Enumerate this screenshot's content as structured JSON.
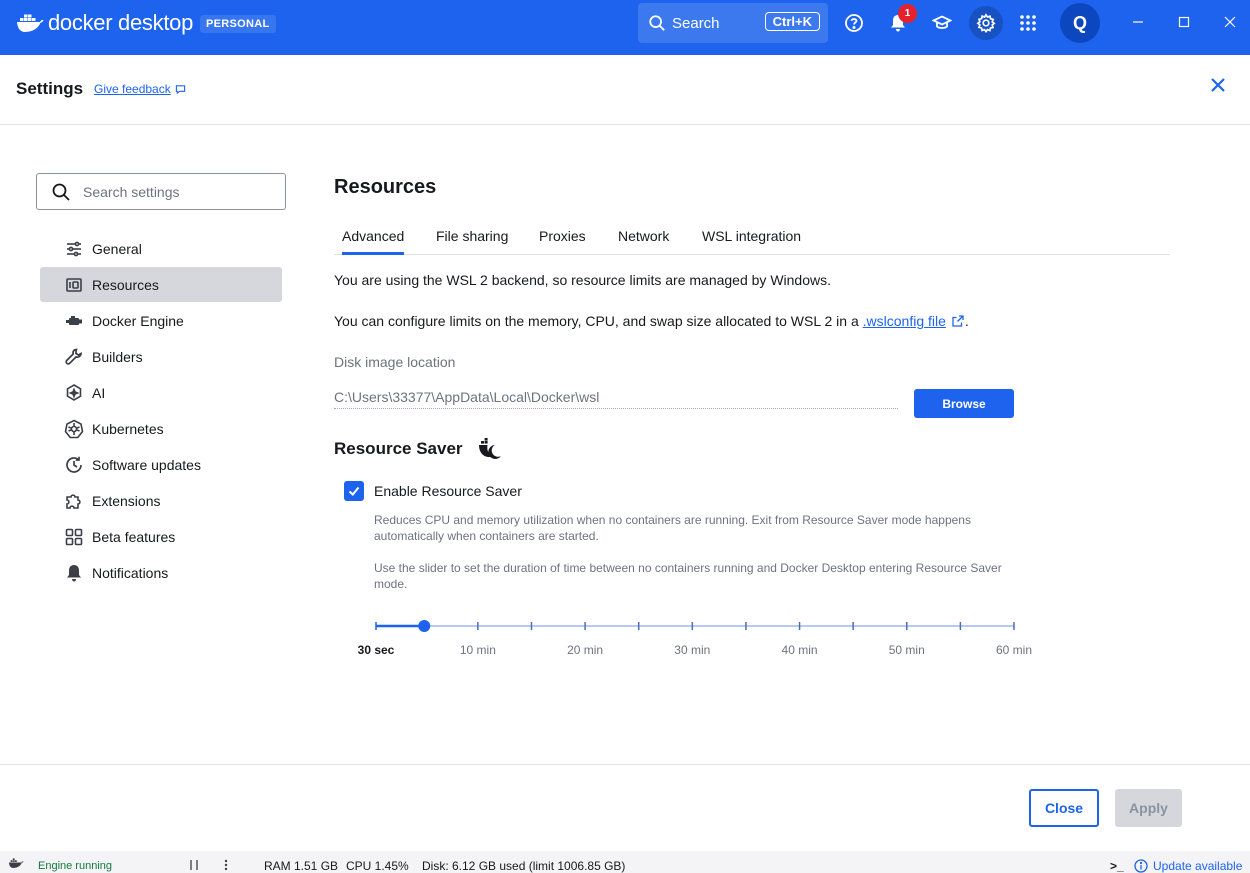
{
  "app": {
    "name": "docker desktop",
    "plan": "PERSONAL",
    "search_label": "Search",
    "search_shortcut": "Ctrl+K",
    "notification_count": "1",
    "avatar_initial": "Q"
  },
  "header": {
    "title": "Settings",
    "feedback_link": "Give feedback"
  },
  "sidebar": {
    "search_placeholder": "Search settings",
    "items": [
      {
        "label": "General",
        "icon": "sliders-icon",
        "active": false
      },
      {
        "label": "Resources",
        "icon": "resources-icon",
        "active": true
      },
      {
        "label": "Docker Engine",
        "icon": "engine-icon",
        "active": false
      },
      {
        "label": "Builders",
        "icon": "wrench-icon",
        "active": false
      },
      {
        "label": "AI",
        "icon": "ai-icon",
        "active": false
      },
      {
        "label": "Kubernetes",
        "icon": "kubernetes-icon",
        "active": false
      },
      {
        "label": "Software updates",
        "icon": "update-clock-icon",
        "active": false
      },
      {
        "label": "Extensions",
        "icon": "puzzle-icon",
        "active": false
      },
      {
        "label": "Beta features",
        "icon": "grid-icon",
        "active": false
      },
      {
        "label": "Notifications",
        "icon": "bell-icon",
        "active": false
      }
    ]
  },
  "main": {
    "title": "Resources",
    "tabs": [
      {
        "label": "Advanced",
        "active": true
      },
      {
        "label": "File sharing",
        "active": false
      },
      {
        "label": "Proxies",
        "active": false
      },
      {
        "label": "Network",
        "active": false
      },
      {
        "label": "WSL integration",
        "active": false
      }
    ],
    "wsl_notice": "You are using the WSL 2 backend, so resource limits are managed by Windows.",
    "limits_text": "You can configure limits on the memory, CPU, and swap size allocated to WSL 2 in a ",
    "limits_link": ".wslconfig file",
    "limits_end": ".",
    "disk_label": "Disk image location",
    "disk_path": "C:\\Users\\33377\\AppData\\Local\\Docker\\wsl",
    "browse_label": "Browse",
    "saver_title": "Resource Saver",
    "saver_checkbox_label": "Enable Resource Saver",
    "saver_enabled": true,
    "saver_desc1": "Reduces CPU and memory utilization when no containers are running. Exit from Resource Saver mode happens automatically when containers are started.",
    "saver_desc2": "Use the slider to set the duration of time between no containers running and Docker Desktop entering Resource Saver mode.",
    "slider": {
      "tick_labels": [
        "30 sec",
        "10 min",
        "20 min",
        "30 min",
        "40 min",
        "50 min",
        "60 min"
      ],
      "tick_minutes": [
        0.5,
        10,
        20,
        30,
        40,
        50,
        60
      ],
      "min_minutes": 0.5,
      "max_minutes": 60,
      "value_minutes": 5
    }
  },
  "footer": {
    "close_label": "Close",
    "apply_label": "Apply"
  },
  "statusbar": {
    "engine": "Engine running",
    "ram": "RAM 1.51 GB",
    "cpu": "CPU 1.45%",
    "disk": "Disk: 6.12 GB used (limit 1006.85 GB)",
    "terminal": ">_",
    "update": "Update available"
  },
  "colors": {
    "brand": "#1d63ed",
    "active_nav": "#d5d7dd",
    "badge": "#e4222d"
  }
}
